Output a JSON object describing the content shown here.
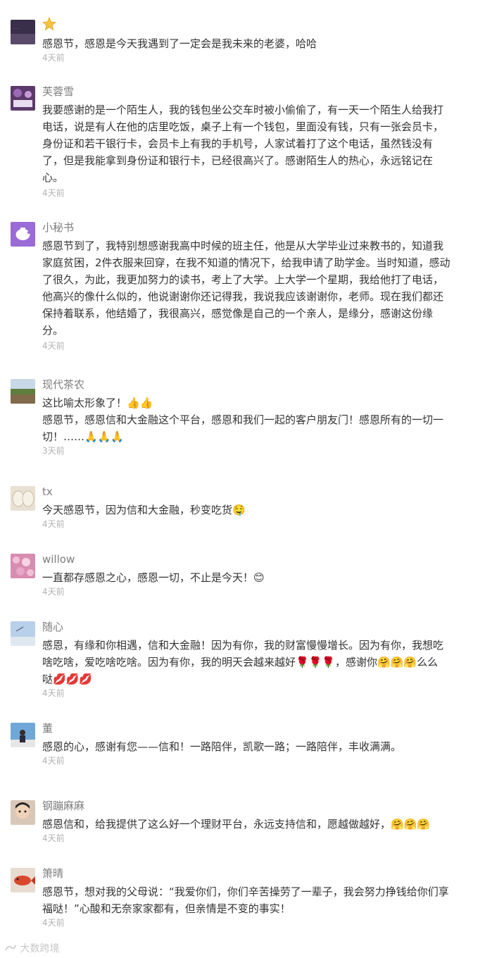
{
  "comments": [
    {
      "name": "",
      "has_star_name": true,
      "lines": [
        "感恩节，感恩是今天我遇到了一定会是我未来的老婆，哈哈"
      ],
      "time": "4天前",
      "avatar": "dark-purple-photo"
    },
    {
      "name": "芙蓉雪",
      "lines": [
        "我要感谢的是一个陌生人，我的钱包坐公交车时被小偷偷了，有一天一个陌生人给我打",
        "电话，说是有人在他的店里吃饭，桌子上有一个钱包，里面没有钱，只有一张会员卡，",
        "身份证和若干银行卡，会员卡上有我的手机号，人家试着打了这个电话，虽然钱没有",
        "了，但是我能拿到身份证和银行卡，已经很高兴了。感谢陌生人的热心，永远铭记在",
        "心。"
      ],
      "time": "4天前",
      "avatar": "purple-pattern"
    },
    {
      "name": "小秘书",
      "lines": [
        "感恩节到了，我特别想感谢我高中时候的班主任，他是从大学毕业过来教书的，知道我",
        "家庭贫困，2件衣服来回穿，在我不知道的情况下，给我申请了助学金。当时知道，感动",
        "了很久，为此，我更加努力的读书，考上了大学。上大学一个星期，我给他打了电话，",
        "他高兴的像什么似的，他说谢谢你还记得我，我说我应该谢谢你，老师。现在我们都还",
        "保持着联系，他结婚了，我很高兴，感觉像是自己的一个亲人，是缘分，感谢这份缘",
        "分。"
      ],
      "time": "4天前",
      "avatar": "piggy-bank"
    },
    {
      "name": "现代茶农",
      "lines": [
        "这比喻太形象了！👍👍",
        "感恩节，感恩信和大金融这个平台，感恩和我们一起的客户朋友门！感恩所有的一切一",
        "切！……🙏🙏🙏"
      ],
      "time": "3天前",
      "avatar": "landscape"
    },
    {
      "name": "tx",
      "lines": [
        "今天感恩节，因为信和大金融，秒变吃货🤤"
      ],
      "time": "4天前",
      "avatar": "buns"
    },
    {
      "name": "willow",
      "lines": [
        "一直都存感恩之心，感恩一切，不止是今天！😊"
      ],
      "time": "4天前",
      "avatar": "pink-flowers"
    },
    {
      "name": "随心",
      "lines": [
        "感恩，有缘和你相遇，信和大金融！因为有你，我的财富慢慢增长。因为有你，我想吃",
        "啥吃啥，爱吃啥吃啥。因为有你，我的明天会越来越好🌹🌹🌹，感谢你🤗🤗🤗么么",
        "哒💋💋💋"
      ],
      "time": "4天前",
      "avatar": "sky"
    },
    {
      "name": "董",
      "lines": [
        "感恩的心，感谢有您——信和！一路陪伴，凯歌一路；一路陪伴，丰收满满。"
      ],
      "time": "4天前",
      "avatar": "person-blue"
    },
    {
      "name": "钢蹦麻麻",
      "lines": [
        "感恩信和，给我提供了这么好一个理财平台，永远支持信和，愿越做越好，🤗🤗🤗"
      ],
      "time": "4天前",
      "avatar": "child"
    },
    {
      "name": "箫晴",
      "lines": [
        "感恩节，想对我的父母说：“我爱你们，你们辛苦操劳了一辈子，我会努力挣钱给你们享",
        "福哒！”心酸和无奈家家都有，但亲情是不变的事实！"
      ],
      "time": "4天前",
      "avatar": "red-fish"
    }
  ],
  "watermark": "大数跨境"
}
